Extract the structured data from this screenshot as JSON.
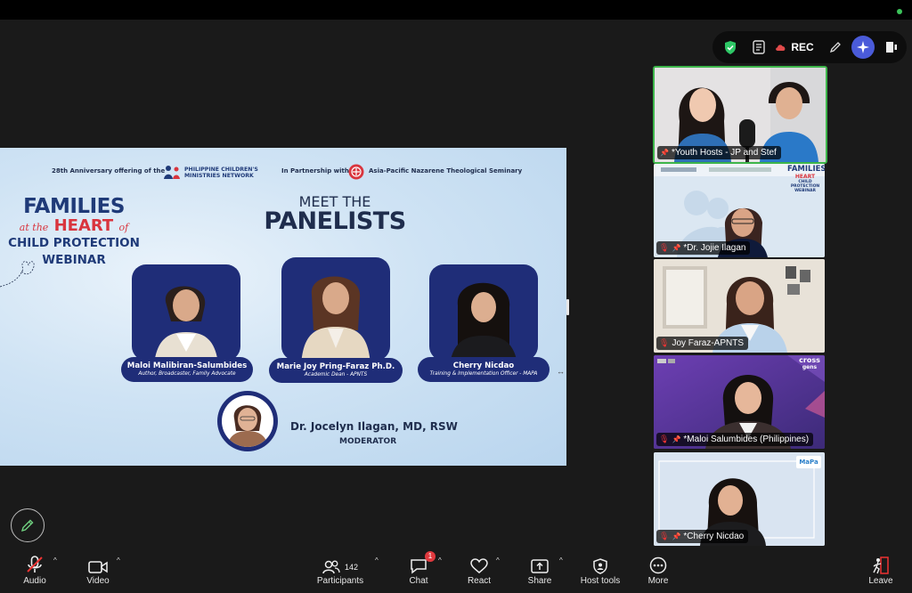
{
  "top_toolbar": {
    "rec_label": "REC"
  },
  "slide": {
    "top_left_text": "28th Anniversary offering of the",
    "org1_line1": "PHILIPPINE CHILDREN'S",
    "org1_line2": "MINISTRIES NETWORK",
    "partner_text": "In Partnership with",
    "org2_name": "Asia-Pacific Nazarene Theological Seminary",
    "title_line1": "FAMILIES",
    "title_at_the": "at the",
    "title_heart": "HEART",
    "title_of": "of",
    "title_line3": "CHILD PROTECTION",
    "title_line4": "WEBINAR",
    "meet_line1": "MEET THE",
    "meet_line2": "PANELISTS",
    "panelists": [
      {
        "name": "Maloi Malibiran-Salumbides",
        "role": "Author, Broadcaster, Family Advocate"
      },
      {
        "name": "Marie Joy Pring-Faraz Ph.D.",
        "role": "Academic Dean - APNTS"
      },
      {
        "name": "Cherry Nicdao",
        "role": "Training & Implementation Officer - MAPA"
      }
    ],
    "moderator_name": "Dr. Jocelyn Ilagan, MD, RSW",
    "moderator_role": "MODERATOR"
  },
  "tiles": [
    {
      "name": "*Youth Hosts - JP and Stef"
    },
    {
      "name": "*Dr. Jojie Ilagan"
    },
    {
      "name": "Joy Faraz-APNTS"
    },
    {
      "name": "*Maloi Salumbides (Philippines)"
    },
    {
      "name": "*Cherry Nicdao"
    }
  ],
  "tile_overlays": {
    "families": "FAMILIES",
    "heart": "HEART",
    "child_protection": "CHILD PROTECTION",
    "webinar": "WEBINAR",
    "cross": "cross",
    "gens": "gens",
    "mapa": "MaPa"
  },
  "toolbar": {
    "audio": "Audio",
    "video": "Video",
    "participants": "Participants",
    "participants_count": "142",
    "chat": "Chat",
    "chat_badge": "1",
    "react": "React",
    "share": "Share",
    "host_tools": "Host tools",
    "more": "More",
    "leave": "Leave"
  },
  "colors": {
    "active_speaker": "#3db54a",
    "slide_navy": "#1f2d78",
    "accent_red": "#d9353e"
  }
}
